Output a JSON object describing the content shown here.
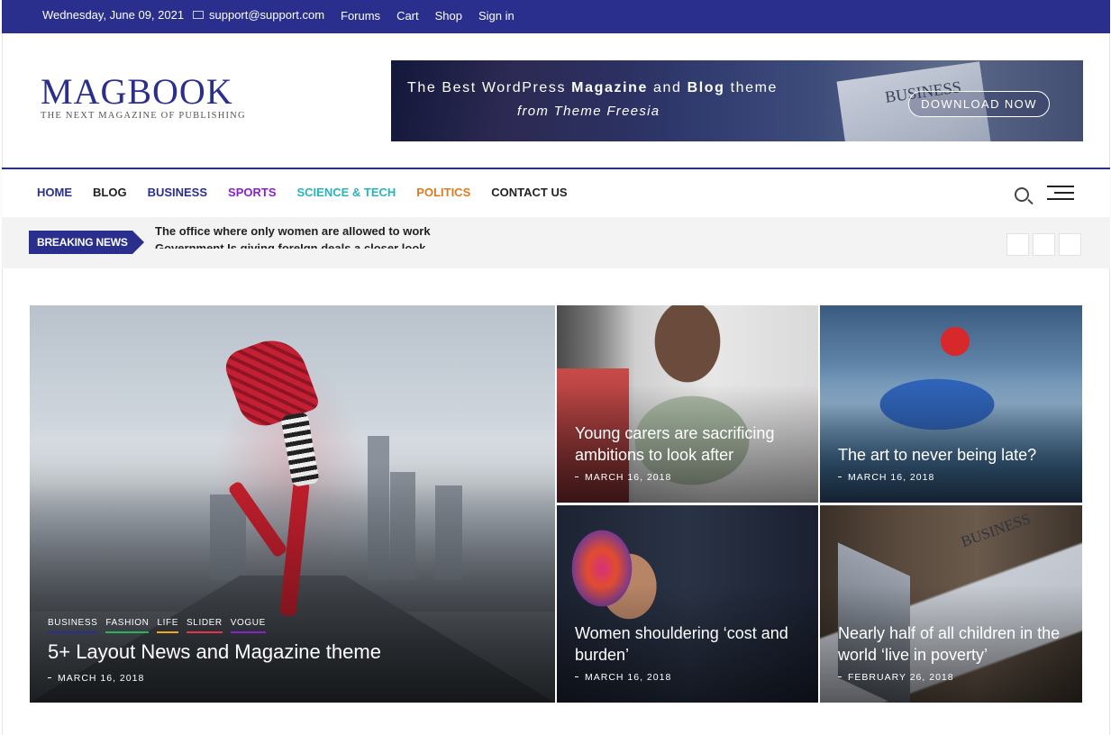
{
  "topbar": {
    "date": "Wednesday, June 09, 2021",
    "email": "support@support.com",
    "links": [
      "Forums",
      "Cart",
      "Shop",
      "Sign in"
    ]
  },
  "logo": {
    "name_part1": "MAG",
    "name_part2": "BOOK",
    "tagline": "THE NEXT MAGAZINE OF PUBLISHING"
  },
  "banner": {
    "line1_a": "The Best WordPress ",
    "line1_b": "Magazine",
    "line1_c": " and ",
    "line1_d": "Blog",
    "line1_e": " theme",
    "line2": "from Theme Freesia",
    "cta": "DOWNLOAD NOW",
    "newspaper_title": "BUSINESS"
  },
  "nav": {
    "items": [
      {
        "label": "HOME",
        "color": "#2a2f8d"
      },
      {
        "label": "BLOG",
        "color": "#222222"
      },
      {
        "label": "BUSINESS",
        "color": "#2a2f8d"
      },
      {
        "label": "SPORTS",
        "color": "#8a21c9"
      },
      {
        "label": "SCIENCE & TECH",
        "color": "#2ab3b8"
      },
      {
        "label": "POLITICS",
        "color": "#e07a1f"
      },
      {
        "label": "CONTACT US",
        "color": "#222222"
      }
    ]
  },
  "breaking": {
    "label": "BREAKING NEWS",
    "headline_1": "The office where only women are allowed to work",
    "headline_2": "Government Is giving foreIgn deals a closer look"
  },
  "featured": {
    "main": {
      "categories": [
        {
          "label": "BUSINESS",
          "color": "#2a2f8d"
        },
        {
          "label": "FASHION",
          "color": "#2bb35a"
        },
        {
          "label": "LIFE",
          "color": "#f2a81d"
        },
        {
          "label": "SLIDER",
          "color": "#e2364a"
        },
        {
          "label": "VOGUE",
          "color": "#8a21c9"
        }
      ],
      "title": "5+ Layout News and Magazine theme",
      "date": "MARCH 16, 2018"
    },
    "posts": [
      {
        "title": "Young carers are sacrificing ambitions to look after",
        "date": "MARCH 16, 2018"
      },
      {
        "title": "The art to never being late?",
        "date": "MARCH 16, 2018"
      },
      {
        "title": "Women shouldering ‘cost and burden’",
        "date": "MARCH 16, 2018"
      },
      {
        "title": "Nearly half of all children in the world ‘live in poverty’",
        "date": "FEBRUARY 26, 2018",
        "newspaper_title": "BUSINESS"
      }
    ]
  },
  "colors": {
    "brand": "#2a2f8d",
    "breaking_bg": "#f3f3f3"
  }
}
